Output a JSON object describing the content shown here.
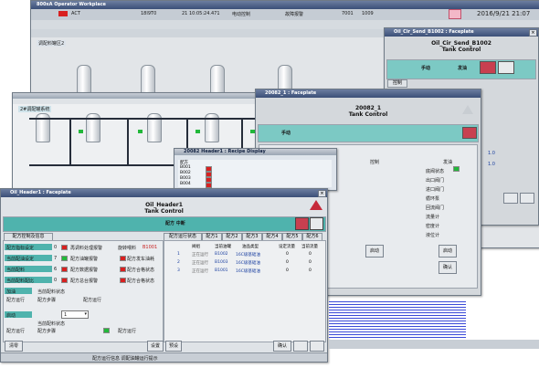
{
  "datetime": "2016/9/21 21:07",
  "colors": {
    "teal": "#4fb3ad",
    "alarm_red": "#d82020",
    "running_green": "#22b83a",
    "alarm_bg": "#f3b8c8"
  },
  "main_window": {
    "title": "800xA Operator Workplace",
    "alarm_ack": "ACT",
    "status_items": [
      "18I9T0",
      "21 10:05:24.471",
      "电动控制",
      "故障报警",
      "7001",
      "1009"
    ],
    "display_title": "调配料罐区2",
    "sub_display": "2#调配罐系统"
  },
  "top_right_faceplate": {
    "title": "Oil_Cir_Send_B1002 : Faceplate",
    "name": "Oil_Cir_Send_B1002",
    "subtitle": "Tank Control",
    "mode": "手动",
    "action": "发油",
    "tab": "控制",
    "values": [
      "1.0",
      "1.0"
    ]
  },
  "mid_faceplate": {
    "title": "20082_1 : Faceplate",
    "name": "20082_1",
    "subtitle": "Tank Control",
    "mode": "手动",
    "right_labels": [
      "控制",
      "发油"
    ],
    "rows": [
      "底阀状态",
      "出口阀门",
      "进口阀门",
      "循环泵",
      "回流阀门",
      "流量计",
      "密度计",
      "液位计"
    ],
    "bottom_buttons": [
      "启动",
      "启动"
    ],
    "confirm": "确认"
  },
  "recipe_window": {
    "title": "20082 Header1 : Recipe Display",
    "cols": [
      "配方",
      "1",
      "2",
      "3",
      "4",
      "5",
      "6"
    ],
    "rows": [
      "B001",
      "B002",
      "B003",
      "B004",
      "B005",
      "B006"
    ]
  },
  "header_faceplate": {
    "title": "Oil_Header1 : Faceplate",
    "name": "Oil_Header1",
    "subtitle": "Tank Control",
    "mode_line": "配方 中断",
    "left_tab": "配方控制及信息",
    "left_rows": [
      {
        "label": "配方指标设定",
        "value": "0",
        "right": "再调料处理报警",
        "state": "red"
      },
      {
        "label": "当前配油设定",
        "value": "7",
        "right": "配方油罐报警",
        "state": "green"
      },
      {
        "label": "当前配料",
        "value": "6",
        "right": "配方数据报警",
        "state": "red"
      },
      {
        "label": "当前配料配比",
        "value": "0",
        "right": "配方总台报警",
        "state": "red"
      }
    ],
    "right_column": [
      "旋转喂料",
      "配方发车油耗",
      "配方合格状态",
      "配方合格状态"
    ],
    "right_value": "B1001",
    "group1": {
      "title": "加油",
      "rows": [
        "当前配料状态",
        "配方运行",
        "配方步骤",
        "配方运行"
      ]
    },
    "group2": {
      "title": "启动",
      "rows": [
        "当前配料状态",
        "配方运行",
        "配方步骤",
        "配方运行"
      ],
      "select_value": "1"
    },
    "right_tabs": [
      "配方运行状态",
      "配方1",
      "配方2",
      "配方3",
      "配方4",
      "配方5",
      "配方6"
    ],
    "table_headers": [
      "",
      "阀组",
      "当前油罐",
      "油品类型",
      "设定流量",
      "当前流量"
    ],
    "table_rows": [
      {
        "no": "1",
        "group": "正在运行",
        "tank": "B1002",
        "oil": "16C级基础油",
        "set": "0",
        "cur": "0"
      },
      {
        "no": "2",
        "group": "正在运行",
        "tank": "B1003",
        "oil": "16C级基础油",
        "set": "0",
        "cur": "0"
      },
      {
        "no": "3",
        "group": "正在运行",
        "tank": "B1001",
        "oil": "16C级基础油",
        "set": "0",
        "cur": "0"
      }
    ],
    "footer_left": "清零",
    "footer_buttons": [
      "设置",
      "预设",
      "确认"
    ],
    "status_bar": "配方运行信息 调配油罐运行提示"
  }
}
